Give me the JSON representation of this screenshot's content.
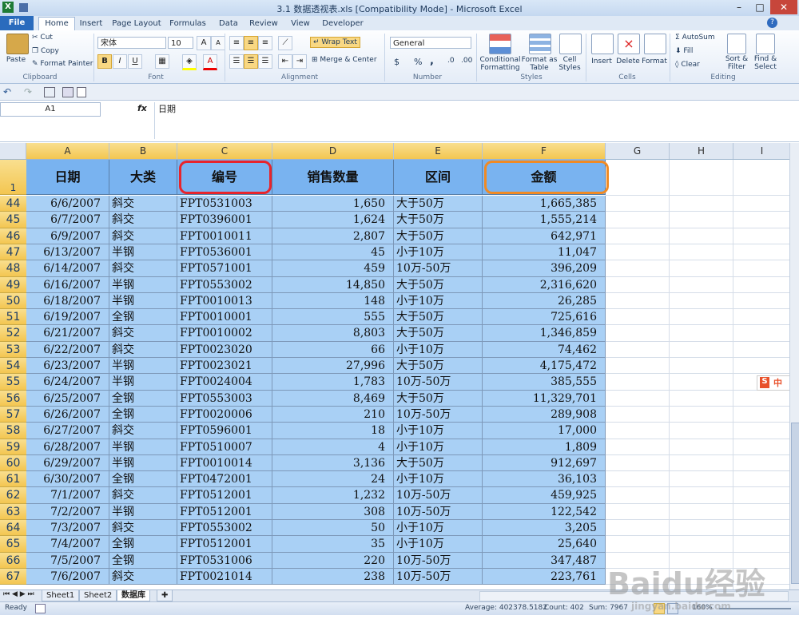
{
  "window": {
    "title": "3.1 数据透视表.xls  [Compatibility Mode] - Microsoft Excel",
    "min": "–",
    "max": "□",
    "close": "✕"
  },
  "tabs": [
    "File",
    "Home",
    "Insert",
    "Page Layout",
    "Formulas",
    "Data",
    "Review",
    "View",
    "Developer"
  ],
  "ribbon": {
    "clipboard": {
      "paste": "Paste",
      "cut": "Cut",
      "copy": "Copy",
      "format_painter": "Format Painter",
      "label": "Clipboard"
    },
    "font": {
      "name": "宋体",
      "size": "10",
      "label": "Font",
      "bold": "B",
      "italic": "I",
      "underline": "U"
    },
    "alignment": {
      "wrap": "Wrap Text",
      "merge": "Merge & Center",
      "label": "Alignment"
    },
    "number": {
      "format": "General",
      "currency": "$",
      "percent": "%",
      "comma": ",",
      "label": "Number"
    },
    "styles": {
      "cond": "Conditional Formatting",
      "table": "Format as Table",
      "cell": "Cell Styles",
      "label": "Styles"
    },
    "cells": {
      "insert": "Insert",
      "delete": "Delete",
      "format": "Format",
      "label": "Cells"
    },
    "editing": {
      "autosum": "AutoSum",
      "fill": "Fill",
      "clear": "Clear",
      "sort": "Sort & Filter",
      "find": "Find & Select",
      "label": "Editing"
    }
  },
  "formula_bar": {
    "name_box": "A1",
    "fx": "fx",
    "content": "日期"
  },
  "columns": [
    "A",
    "B",
    "C",
    "D",
    "E",
    "F",
    "G",
    "H",
    "I"
  ],
  "header_row": {
    "num": "1",
    "cells": [
      "日期",
      "大类",
      "编号",
      "销售数量",
      "区间",
      "金额"
    ]
  },
  "rows": [
    {
      "n": "44",
      "a": "6/6/2007",
      "b": "斜交",
      "c": "FPT0531003",
      "d": "1,650",
      "e": "大于50万",
      "f": "1,665,385"
    },
    {
      "n": "45",
      "a": "6/7/2007",
      "b": "斜交",
      "c": "FPT0396001",
      "d": "1,624",
      "e": "大于50万",
      "f": "1,555,214"
    },
    {
      "n": "46",
      "a": "6/9/2007",
      "b": "斜交",
      "c": "FPT0010011",
      "d": "2,807",
      "e": "大于50万",
      "f": "642,971"
    },
    {
      "n": "47",
      "a": "6/13/2007",
      "b": "半钢",
      "c": "FPT0536001",
      "d": "45",
      "e": "小于10万",
      "f": "11,047"
    },
    {
      "n": "48",
      "a": "6/14/2007",
      "b": "斜交",
      "c": "FPT0571001",
      "d": "459",
      "e": "10万-50万",
      "f": "396,209"
    },
    {
      "n": "49",
      "a": "6/16/2007",
      "b": "半钢",
      "c": "FPT0553002",
      "d": "14,850",
      "e": "大于50万",
      "f": "2,316,620"
    },
    {
      "n": "50",
      "a": "6/18/2007",
      "b": "半钢",
      "c": "FPT0010013",
      "d": "148",
      "e": "小于10万",
      "f": "26,285"
    },
    {
      "n": "51",
      "a": "6/19/2007",
      "b": "全钢",
      "c": "FPT0010001",
      "d": "555",
      "e": "大于50万",
      "f": "725,616"
    },
    {
      "n": "52",
      "a": "6/21/2007",
      "b": "斜交",
      "c": "FPT0010002",
      "d": "8,803",
      "e": "大于50万",
      "f": "1,346,859"
    },
    {
      "n": "53",
      "a": "6/22/2007",
      "b": "斜交",
      "c": "FPT0023020",
      "d": "66",
      "e": "小于10万",
      "f": "74,462"
    },
    {
      "n": "54",
      "a": "6/23/2007",
      "b": "半钢",
      "c": "FPT0023021",
      "d": "27,996",
      "e": "大于50万",
      "f": "4,175,472"
    },
    {
      "n": "55",
      "a": "6/24/2007",
      "b": "半钢",
      "c": "FPT0024004",
      "d": "1,783",
      "e": "10万-50万",
      "f": "385,555"
    },
    {
      "n": "56",
      "a": "6/25/2007",
      "b": "全钢",
      "c": "FPT0553003",
      "d": "8,469",
      "e": "大于50万",
      "f": "11,329,701"
    },
    {
      "n": "57",
      "a": "6/26/2007",
      "b": "全钢",
      "c": "FPT0020006",
      "d": "210",
      "e": "10万-50万",
      "f": "289,908"
    },
    {
      "n": "58",
      "a": "6/27/2007",
      "b": "斜交",
      "c": "FPT0596001",
      "d": "18",
      "e": "小于10万",
      "f": "17,000"
    },
    {
      "n": "59",
      "a": "6/28/2007",
      "b": "半钢",
      "c": "FPT0510007",
      "d": "4",
      "e": "小于10万",
      "f": "1,809"
    },
    {
      "n": "60",
      "a": "6/29/2007",
      "b": "半钢",
      "c": "FPT0010014",
      "d": "3,136",
      "e": "大于50万",
      "f": "912,697"
    },
    {
      "n": "61",
      "a": "6/30/2007",
      "b": "全钢",
      "c": "FPT0472001",
      "d": "24",
      "e": "小于10万",
      "f": "36,103"
    },
    {
      "n": "62",
      "a": "7/1/2007",
      "b": "斜交",
      "c": "FPT0512001",
      "d": "1,232",
      "e": "10万-50万",
      "f": "459,925"
    },
    {
      "n": "63",
      "a": "7/2/2007",
      "b": "半钢",
      "c": "FPT0512001",
      "d": "308",
      "e": "10万-50万",
      "f": "122,542"
    },
    {
      "n": "64",
      "a": "7/3/2007",
      "b": "斜交",
      "c": "FPT0553002",
      "d": "50",
      "e": "小于10万",
      "f": "3,205"
    },
    {
      "n": "65",
      "a": "7/4/2007",
      "b": "全钢",
      "c": "FPT0512001",
      "d": "35",
      "e": "小于10万",
      "f": "25,640"
    },
    {
      "n": "66",
      "a": "7/5/2007",
      "b": "全钢",
      "c": "FPT0531006",
      "d": "220",
      "e": "10万-50万",
      "f": "347,487"
    },
    {
      "n": "67",
      "a": "7/6/2007",
      "b": "斜交",
      "c": "FPT0021014",
      "d": "238",
      "e": "10万-50万",
      "f": "223,761"
    }
  ],
  "sheets": [
    "Sheet1",
    "Sheet2",
    "数据库"
  ],
  "status": {
    "ready": "Ready",
    "average": "Average: 402378.5182",
    "count": "Count: 402",
    "sum": "Sum: 7967",
    "zoom": "160%"
  },
  "highlights": {
    "red": "#e8242c",
    "orange": "#f08a24"
  },
  "widget": {
    "s": "S",
    "zh": "中"
  },
  "watermark": {
    "brand": "Baidu经验",
    "site": "jingyan.baidu.com"
  }
}
